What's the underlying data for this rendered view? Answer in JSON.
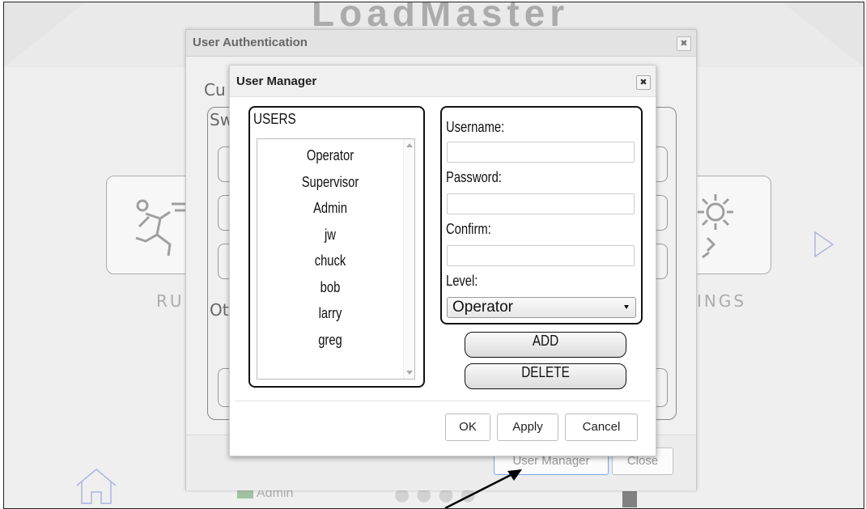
{
  "background": {
    "app_title": "LoadMaster",
    "tiles": [
      {
        "label": "RU"
      },
      {
        "label": "INGS"
      }
    ],
    "status_user": "Admin",
    "next_icon": "play-triangle-icon",
    "home_icon": "home-icon",
    "settings_icon": "gear-icon",
    "run_icon": "running-man-icon"
  },
  "auth_dialog": {
    "title": "User Authentication",
    "current_label": "Cu",
    "switch_label": "Sw",
    "other_label": "Ot",
    "buttons": {
      "user_manager": "User Manager",
      "close": "Close"
    }
  },
  "user_manager": {
    "title": "User Manager",
    "close_icon": "close-icon",
    "users_heading": "USERS",
    "users": [
      "Operator",
      "Supervisor",
      "Admin",
      "jw",
      "chuck",
      "bob",
      "larry",
      "greg"
    ],
    "form": {
      "username_label": "Username:",
      "username_value": "",
      "password_label": "Password:",
      "password_value": "",
      "confirm_label": "Confirm:",
      "confirm_value": "",
      "level_label": "Level:",
      "level_value": "Operator"
    },
    "actions": {
      "add": "ADD",
      "delete": "DELETE"
    },
    "footer": {
      "ok": "OK",
      "apply": "Apply",
      "cancel": "Cancel"
    }
  },
  "colors": {
    "dialog_border": "#111111",
    "active_button_border": "#7ea6e0",
    "background": "#ececec"
  }
}
